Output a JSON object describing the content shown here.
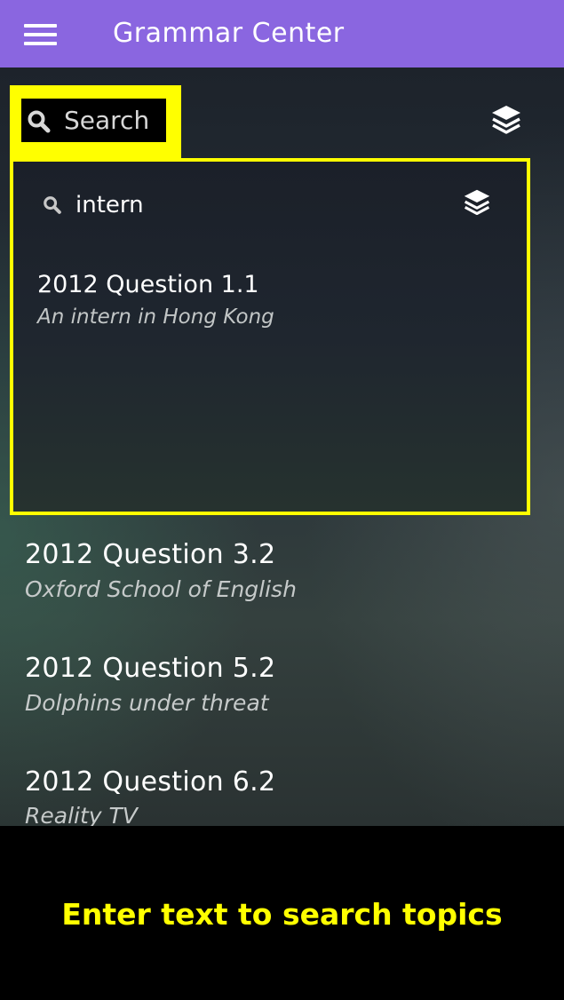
{
  "app_bar": {
    "title": "Grammar Center"
  },
  "search": {
    "placeholder": "Search"
  },
  "overlay": {
    "query": "intern",
    "results": [
      {
        "title": "2012 Question 1.1",
        "subtitle": "An intern in Hong Kong"
      }
    ]
  },
  "list": {
    "items": [
      {
        "title": "2012 Question 3.2",
        "subtitle": "Oxford School of English"
      },
      {
        "title": "2012 Question 5.2",
        "subtitle": "Dolphins under threat"
      },
      {
        "title": "2012 Question 6.2",
        "subtitle": "Reality TV"
      }
    ]
  },
  "caption": "Enter text to search topics",
  "colors": {
    "app_bar": "#8a66e0",
    "highlight": "#ffff00",
    "caption_text": "#ffff00"
  },
  "icons": [
    "menu-icon",
    "search-icon",
    "layers-icon"
  ]
}
